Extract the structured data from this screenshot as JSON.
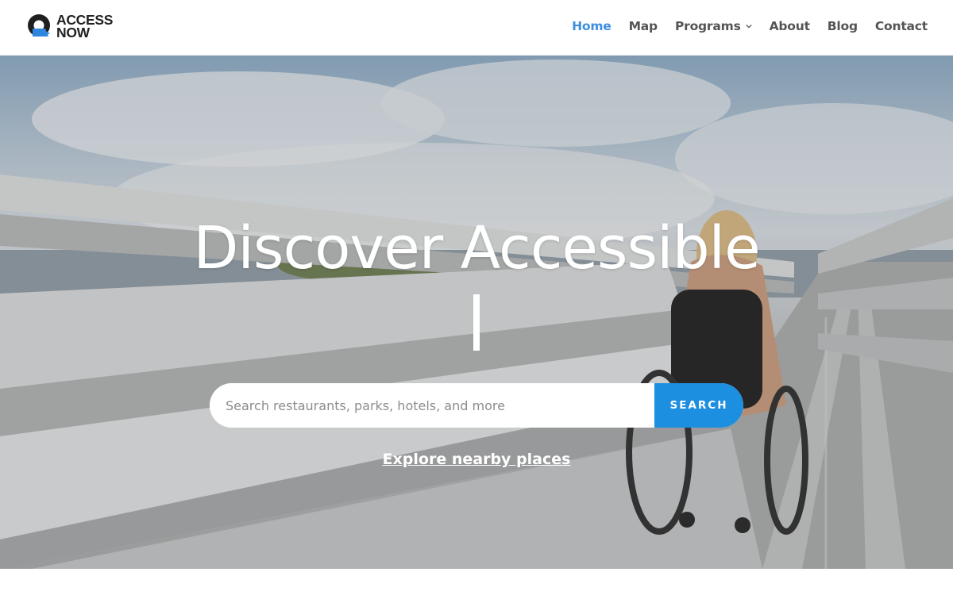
{
  "brand": {
    "name_line1": "ACCESS",
    "name_line2": "NOW",
    "logo_icon": "access-now-logo-icon",
    "colors": {
      "dark": "#1f1f1f",
      "blue": "#2e86de"
    }
  },
  "nav": {
    "items": [
      {
        "label": "Home",
        "active": true
      },
      {
        "label": "Map",
        "active": false
      },
      {
        "label": "Programs",
        "active": false,
        "has_dropdown": true
      },
      {
        "label": "About",
        "active": false
      },
      {
        "label": "Blog",
        "active": false
      },
      {
        "label": "Contact",
        "active": false
      }
    ],
    "colors": {
      "active": "#3d8fde",
      "default": "#555555"
    }
  },
  "hero": {
    "title": "Discover Accessible",
    "search": {
      "placeholder": "Search restaurants, parks, hotels, and more",
      "value": "",
      "button_label": "SEARCH",
      "button_color": "#1d8fe0"
    },
    "explore_link": "Explore nearby places",
    "background_image": "person-in-wheelchair-on-boardwalk"
  }
}
